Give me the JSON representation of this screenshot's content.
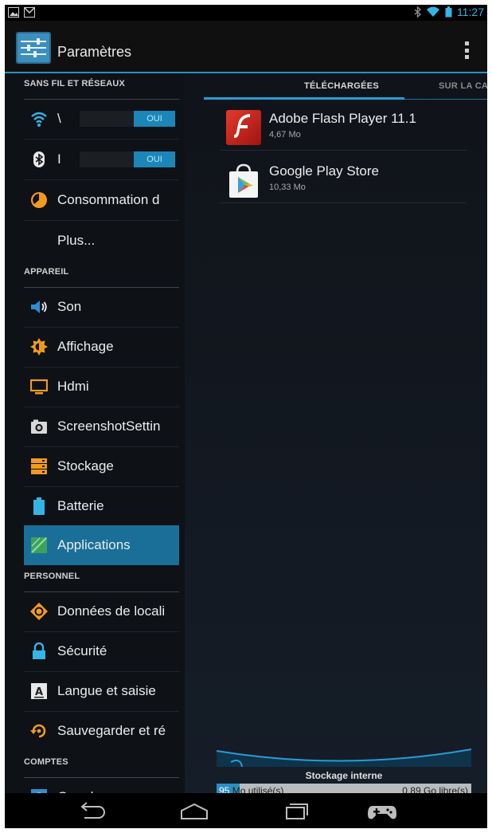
{
  "status_bar": {
    "time": "11:27",
    "left_icons": [
      "image-icon",
      "gmail-icon"
    ],
    "right_icons": [
      "bluetooth-icon",
      "wifi-icon",
      "battery-icon"
    ]
  },
  "action_bar": {
    "title": "Paramètres",
    "icon": "settings-sliders-icon",
    "overflow_icon": "overflow-menu-icon"
  },
  "sections": {
    "wireless": "SANS FIL ET RÉSEAUX",
    "device": "APPAREIL",
    "personal": "PERSONNEL",
    "accounts": "COMPTES"
  },
  "menu": {
    "wifi": {
      "label": "\\",
      "toggle": "OUI",
      "icon": "wifi-icon"
    },
    "bluetooth": {
      "label": "I",
      "toggle": "OUI",
      "icon": "bluetooth-icon"
    },
    "data_usage": {
      "label": "Consommation d",
      "icon": "data-usage-icon"
    },
    "more": {
      "label": "Plus..."
    },
    "sound": {
      "label": "Son",
      "icon": "speaker-icon"
    },
    "display": {
      "label": "Affichage",
      "icon": "brightness-icon"
    },
    "hdmi": {
      "label": "Hdmi",
      "icon": "monitor-icon"
    },
    "screenshot": {
      "label": "ScreenshotSettin",
      "icon": "camera-icon"
    },
    "storage": {
      "label": "Stockage",
      "icon": "storage-icon"
    },
    "battery": {
      "label": "Batterie",
      "icon": "battery-icon"
    },
    "applications": {
      "label": "Applications",
      "icon": "apps-icon",
      "selected": true
    },
    "location": {
      "label": "Données de locali",
      "icon": "location-icon"
    },
    "security": {
      "label": "Sécurité",
      "icon": "lock-icon"
    },
    "language": {
      "label": "Langue et saisie",
      "icon": "keyboard-icon"
    },
    "backup": {
      "label": "Sauvegarder et ré",
      "icon": "backup-icon"
    },
    "google": {
      "label": "Google",
      "icon": "google-icon"
    }
  },
  "tabs": {
    "downloaded": "TÉLÉCHARGÉES",
    "sd_card": "SUR LA CA"
  },
  "apps": [
    {
      "name": "Adobe Flash Player 11.1",
      "size": "4,67 Mo",
      "icon": "flash-icon"
    },
    {
      "name": "Google Play Store",
      "size": "10,33 Mo",
      "icon": "play-store-icon"
    }
  ],
  "storage": {
    "label": "Stockage interne",
    "used_value": "95",
    "used_text": "Mo utilisé(s)",
    "free_text": "0,89 Go libre(s)",
    "used_fraction": 0.09
  },
  "colors": {
    "accent": "#33b5e5",
    "selected": "#1a6f98"
  }
}
